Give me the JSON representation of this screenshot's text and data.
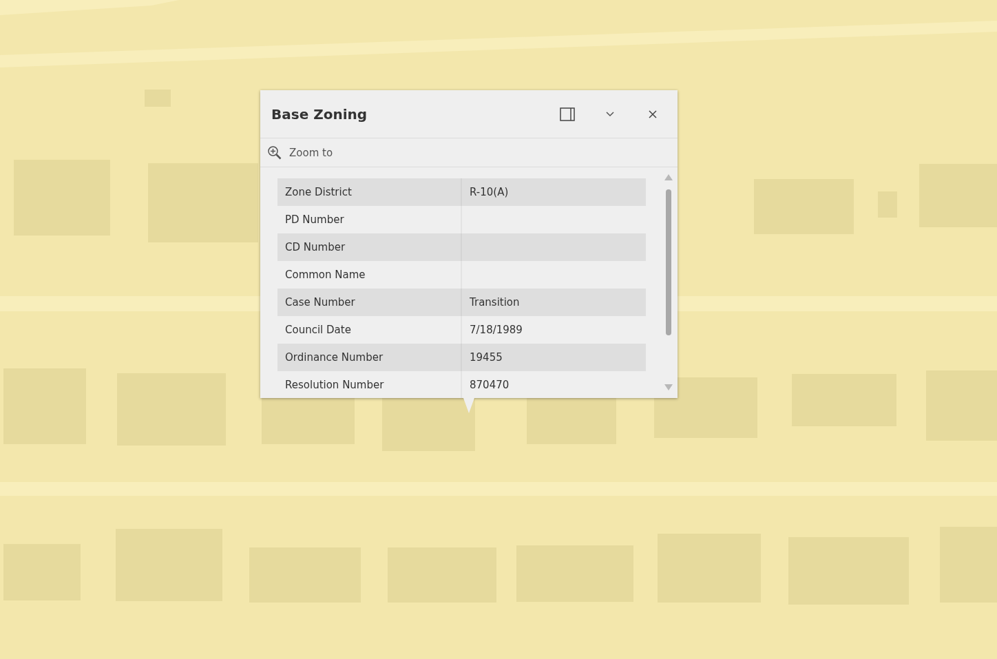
{
  "popup": {
    "title": "Base Zoning",
    "zoom_action": "Zoom to",
    "fields": [
      {
        "label": "Zone District",
        "value": "R-10(A)"
      },
      {
        "label": "PD Number"
      },
      {
        "label": "CD Number"
      },
      {
        "label": "Common Name"
      },
      {
        "label": "Case Number",
        "value": "Transition"
      },
      {
        "label": "Council Date",
        "value": "7/18/1989"
      },
      {
        "label": "Ordinance Number",
        "value": "19455"
      },
      {
        "label": "Resolution Number",
        "value": "870470"
      }
    ]
  }
}
